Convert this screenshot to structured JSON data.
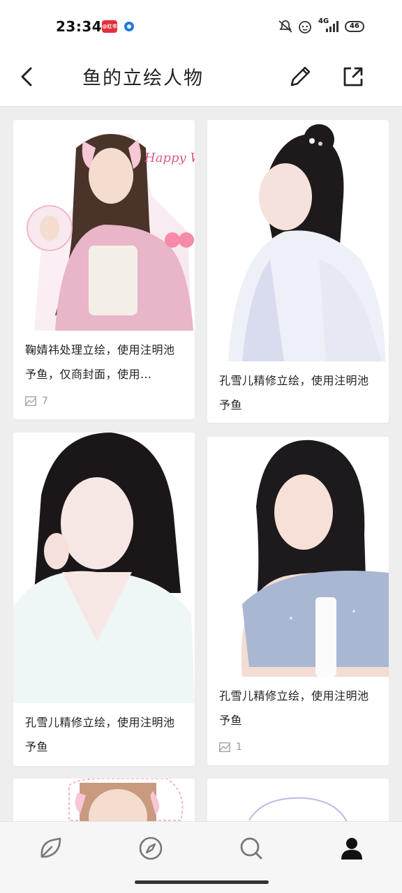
{
  "status": {
    "time": "23:34",
    "app_badge": "@红书",
    "network": "4G",
    "battery": "46",
    "colors": {
      "badge": "#e0313a",
      "dot": "#1f7bdc"
    }
  },
  "header": {
    "title": "鱼的立绘人物",
    "back_icon": "chevron-left-icon",
    "edit_icon": "pencil-icon",
    "share_icon": "share-export-icon"
  },
  "cards": [
    {
      "title": "鞠婧祎处理立绘，使用注明池予鱼，仅商封面，使用…",
      "image_count": "7",
      "image_icon": "image-icon",
      "image_text": "Happy Women's Day"
    },
    {
      "title": "孔雪儿精修立绘，使用注明池予鱼"
    },
    {
      "title": "孔雪儿精修立绘，使用注明池予鱼"
    },
    {
      "title": "孔雪儿精修立绘，使用注明池予鱼",
      "image_count": "1",
      "image_icon": "image-icon"
    }
  ],
  "bottom_nav": [
    {
      "icon": "leaf-icon",
      "label": "home"
    },
    {
      "icon": "compass-icon",
      "label": "discover"
    },
    {
      "icon": "search-icon",
      "label": "search"
    },
    {
      "icon": "profile-icon",
      "label": "me"
    }
  ]
}
